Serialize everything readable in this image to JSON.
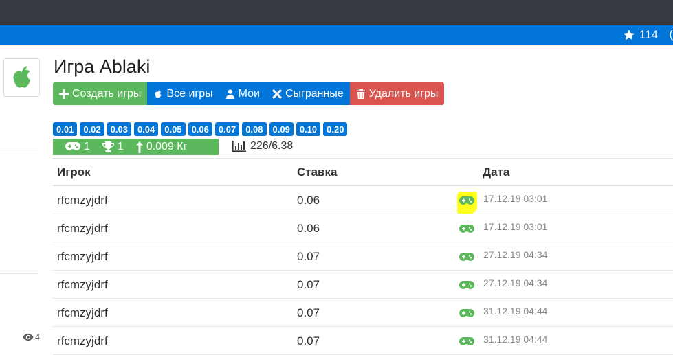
{
  "header": {
    "star_count": "114",
    "edge_glyph": "("
  },
  "colors": {
    "topbar": "#343a40",
    "primary": "#0275d8",
    "success": "#5cb85c",
    "danger": "#d9534f",
    "highlight": "#ffff1a"
  },
  "icons": {
    "logo": "apple-icon",
    "star": "star-icon",
    "views": "eye-icon"
  },
  "sidebar": {
    "views_count": "4"
  },
  "game": {
    "title": "Игра Ablaki",
    "buttons": {
      "create": "Создать игры",
      "all": "Все игры",
      "mine": "Мои",
      "played": "Сыгранные",
      "delete": "Удалить игры"
    },
    "bets": [
      "0.01",
      "0.02",
      "0.03",
      "0.04",
      "0.05",
      "0.06",
      "0.07",
      "0.08",
      "0.09",
      "0.10",
      "0.20"
    ],
    "stats": {
      "games": "1",
      "wins": "1",
      "profit": "0.009 Кг",
      "bank": "226/6.38"
    }
  },
  "table": {
    "headers": {
      "player": "Игрок",
      "bet": "Ставка",
      "date": "Дата"
    },
    "rows": [
      {
        "player": "rfcmzyjdrf",
        "bet": "0.06",
        "date": "17.12.19 03:01",
        "highlighted": true
      },
      {
        "player": "rfcmzyjdrf",
        "bet": "0.06",
        "date": "17.12.19 03:01",
        "highlighted": false
      },
      {
        "player": "rfcmzyjdrf",
        "bet": "0.07",
        "date": "27.12.19 04:34",
        "highlighted": false
      },
      {
        "player": "rfcmzyjdrf",
        "bet": "0.07",
        "date": "27.12.19 04:34",
        "highlighted": false
      },
      {
        "player": "rfcmzyjdrf",
        "bet": "0.07",
        "date": "31.12.19 04:44",
        "highlighted": false
      },
      {
        "player": "rfcmzyjdrf",
        "bet": "0.07",
        "date": "31.12.19 04:44",
        "highlighted": false
      }
    ]
  }
}
